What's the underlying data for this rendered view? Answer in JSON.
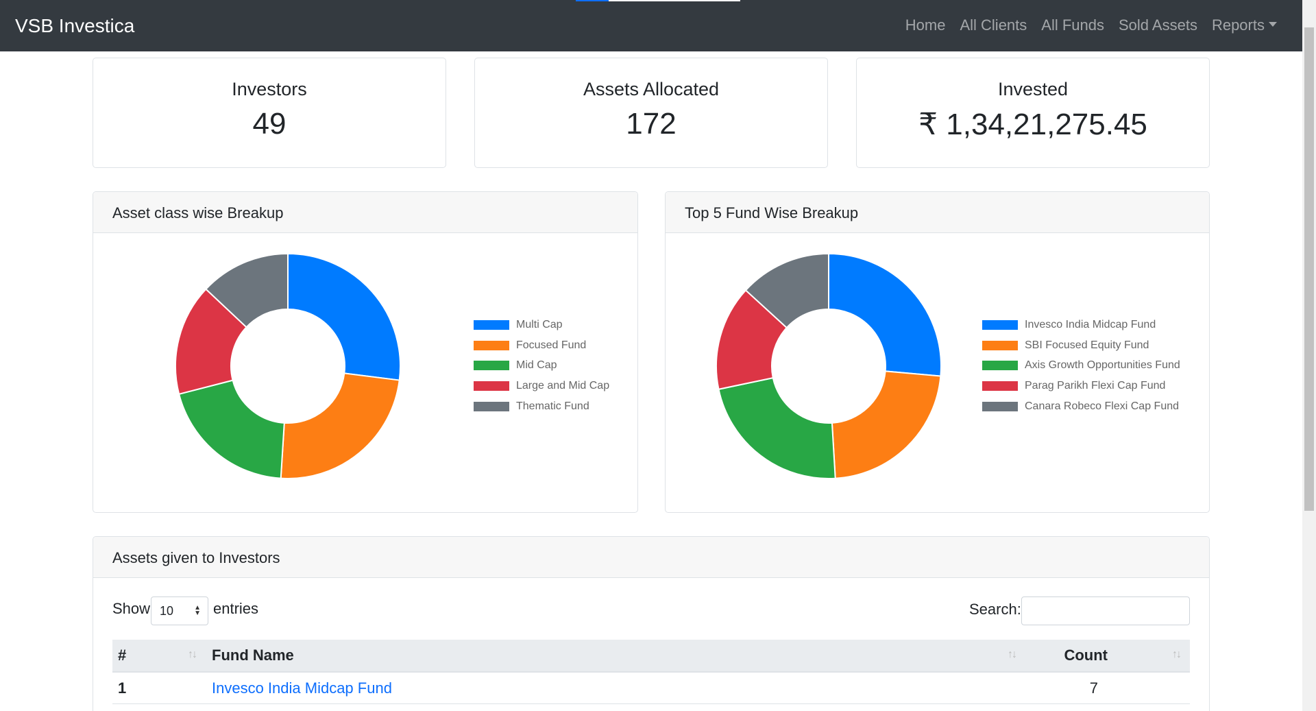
{
  "navbar": {
    "brand": "VSB Investica",
    "links": [
      "Home",
      "All Clients",
      "All Funds",
      "Sold Assets",
      "Reports"
    ]
  },
  "stats": {
    "investors": {
      "title": "Investors",
      "value": "49"
    },
    "assets": {
      "title": "Assets Allocated",
      "value": "172"
    },
    "invested": {
      "title": "Invested",
      "value": "₹ 1,34,21,275.45"
    }
  },
  "asset_card": {
    "title": "Asset class wise Breakup"
  },
  "fund_card": {
    "title": "Top 5 Fund Wise Breakup"
  },
  "chart_data": [
    {
      "type": "pie",
      "title": "Asset class wise Breakup",
      "categories": [
        "Multi Cap",
        "Focused Fund",
        "Mid Cap",
        "Large and Mid Cap",
        "Thematic Fund"
      ],
      "values": [
        27,
        24,
        20,
        16,
        13
      ],
      "colors": [
        "#007bff",
        "#fd7e14",
        "#28a745",
        "#dc3545",
        "#6c757d"
      ],
      "legend": "right"
    },
    {
      "type": "pie",
      "title": "Top 5 Fund Wise Breakup",
      "categories": [
        "Invesco India Midcap Fund",
        "SBI Focused Equity Fund",
        "Axis Growth Opportunities Fund",
        "Parag Parikh Flexi Cap Fund",
        "Canara Robeco Flexi Cap Fund"
      ],
      "values": [
        7,
        6,
        6,
        4,
        3.5
      ],
      "colors": [
        "#007bff",
        "#fd7e14",
        "#28a745",
        "#dc3545",
        "#6c757d"
      ],
      "legend": "right"
    }
  ],
  "table_card": {
    "title": "Assets given to Investors",
    "show_label": "Show",
    "entries_value": "10",
    "entries_label": "entries",
    "search_label": "Search:",
    "headers": [
      "#",
      "Fund Name",
      "Count"
    ],
    "rows": [
      {
        "num": "1",
        "name": "Invesco India Midcap Fund",
        "count": "7"
      }
    ]
  }
}
